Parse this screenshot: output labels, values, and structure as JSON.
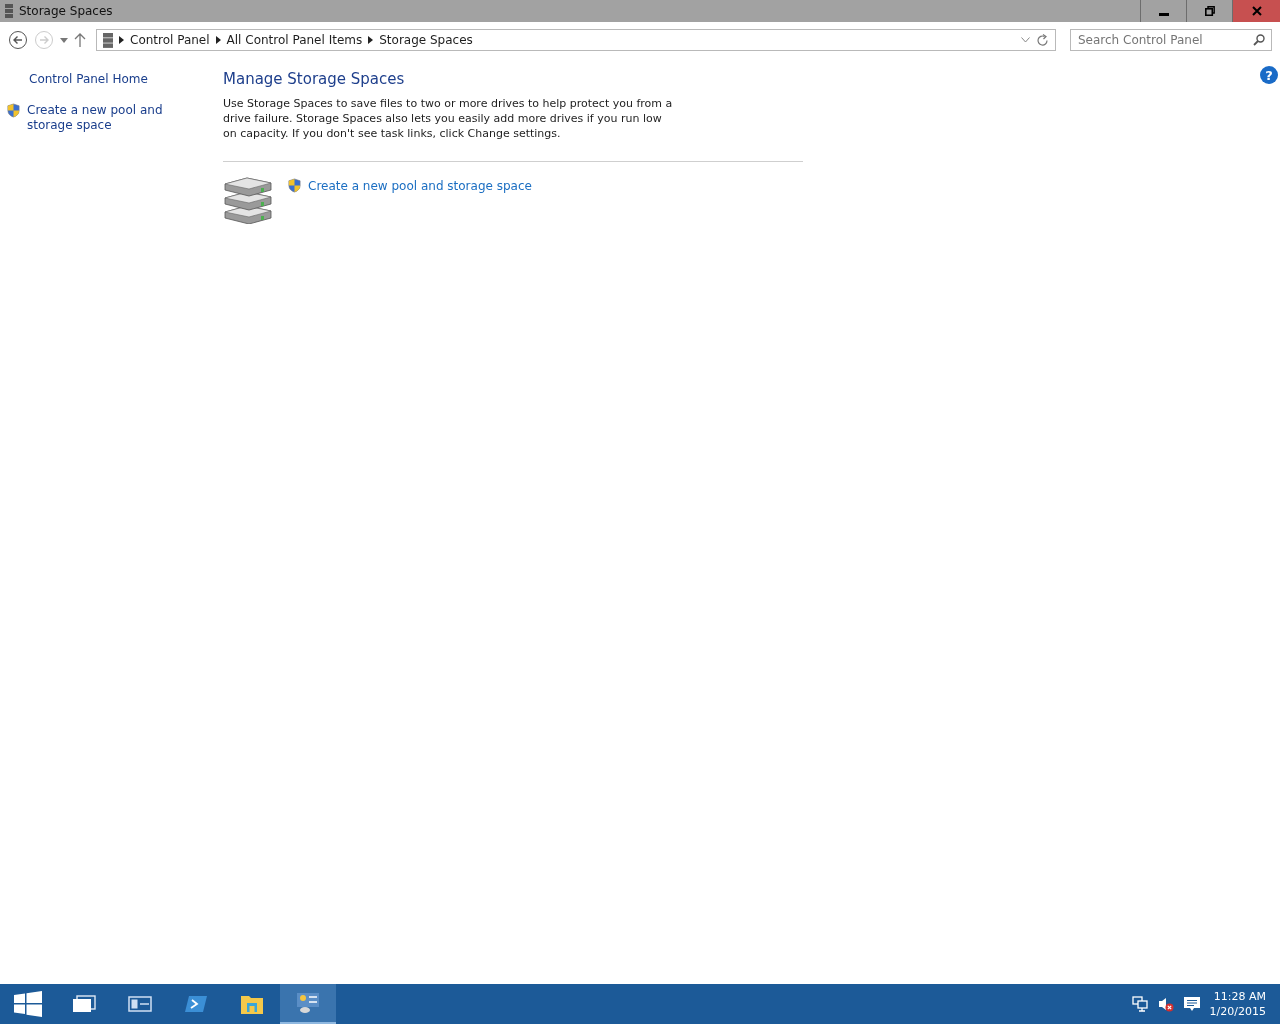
{
  "window": {
    "title": "Storage Spaces"
  },
  "breadcrumb": [
    "Control Panel",
    "All Control Panel Items",
    "Storage Spaces"
  ],
  "search": {
    "placeholder": "Search Control Panel"
  },
  "help": {
    "glyph": "?"
  },
  "sidebar": {
    "items": [
      {
        "label": "Control Panel Home",
        "kind": "plain"
      },
      {
        "label": "Create a new pool and storage space",
        "kind": "shield"
      }
    ]
  },
  "main": {
    "heading": "Manage Storage Spaces",
    "description": "Use Storage Spaces to save files to two or more drives to help protect you from a drive failure. Storage Spaces also lets you easily add more drives if you run low on capacity. If you don't see task links, click Change settings.",
    "task_link": "Create a new pool and storage space"
  },
  "taskbar": {
    "items": [
      {
        "kind": "start",
        "selected": false
      },
      {
        "kind": "taskview",
        "selected": false
      },
      {
        "kind": "server",
        "selected": false
      },
      {
        "kind": "powershell",
        "selected": false
      },
      {
        "kind": "explorer",
        "selected": false
      },
      {
        "kind": "controlpanel",
        "selected": true
      }
    ],
    "time": "11:28 AM",
    "date": "1/20/2015"
  }
}
